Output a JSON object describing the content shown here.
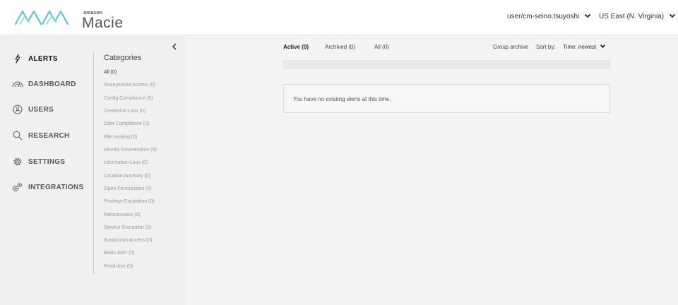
{
  "header": {
    "brand_small": "amazon",
    "brand_name": "Macie",
    "user": "user/cm-seino.tsuyoshi",
    "region": "US East (N. Virginia)"
  },
  "nav": {
    "items": [
      {
        "label": "ALERTS",
        "icon": "lightning-icon",
        "active": true
      },
      {
        "label": "DASHBOARD",
        "icon": "gauge-icon",
        "active": false
      },
      {
        "label": "USERS",
        "icon": "user-circle-icon",
        "active": false
      },
      {
        "label": "RESEARCH",
        "icon": "search-icon",
        "active": false
      },
      {
        "label": "SETTINGS",
        "icon": "gear-icon",
        "active": false
      },
      {
        "label": "INTEGRATIONS",
        "icon": "integrations-icon",
        "active": false
      }
    ]
  },
  "categories": {
    "title": "Categories",
    "items": [
      "All (0)",
      "Anonymized Access (0)",
      "Config Compliance (0)",
      "Credential Loss (0)",
      "Data Compliance (0)",
      "File Hosting (0)",
      "Identity Enumeration (0)",
      "Information Loss (0)",
      "Location Anomaly (0)",
      "Open Permissions (0)",
      "Privilege Escalation (0)",
      "Ransomware (0)",
      "Service Disruption (0)",
      "Suspicious Access (0)",
      "Basic Alert (0)",
      "Predictive (0)"
    ]
  },
  "main": {
    "tabs": [
      "Active (0)",
      "Archived (0)",
      "All (0)"
    ],
    "group_archive": "Group archive",
    "sort_label": "Sort by:",
    "sort_value": "Time: newest",
    "empty_message": "You have no existing alerts at this time."
  },
  "colors": {
    "logo_teal": "#5bc6d3",
    "nav_bg": "#f0f0f0",
    "main_bg": "#f4f4f4"
  }
}
